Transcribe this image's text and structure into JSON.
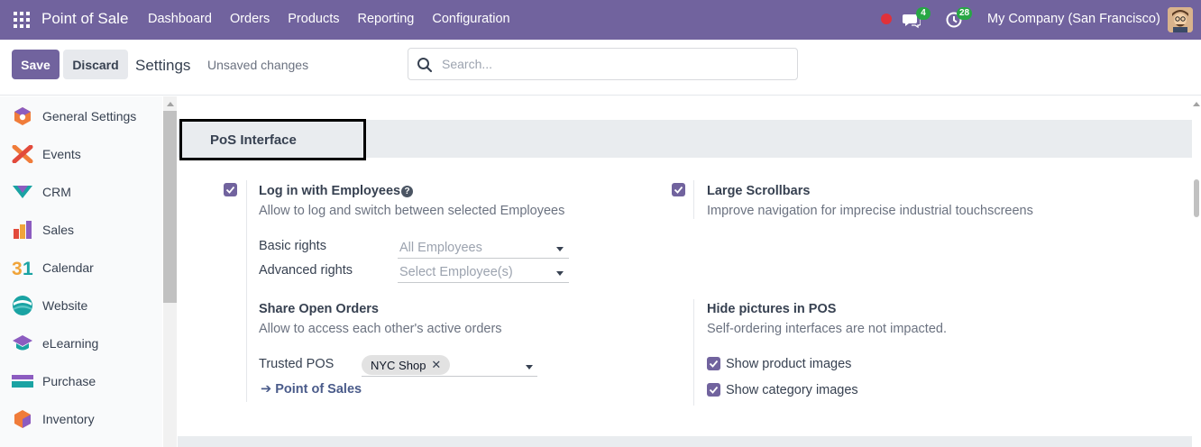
{
  "navbar": {
    "app_name": "Point of Sale",
    "menu": [
      "Dashboard",
      "Orders",
      "Products",
      "Reporting",
      "Configuration"
    ],
    "chat_count": "4",
    "activity_count": "28",
    "company": "My Company (San Francisco)",
    "colors": {
      "bar": "#71639e",
      "badge": "#28a745",
      "record": "#e0313a"
    }
  },
  "control": {
    "save_label": "Save",
    "discard_label": "Discard",
    "title": "Settings",
    "status": "Unsaved changes",
    "search_placeholder": "Search..."
  },
  "sidebar": {
    "items": [
      {
        "label": "General Settings",
        "icon": "general-settings-icon"
      },
      {
        "label": "Events",
        "icon": "events-icon"
      },
      {
        "label": "CRM",
        "icon": "crm-icon"
      },
      {
        "label": "Sales",
        "icon": "sales-icon"
      },
      {
        "label": "Calendar",
        "icon": "calendar-icon"
      },
      {
        "label": "Website",
        "icon": "website-icon"
      },
      {
        "label": "eLearning",
        "icon": "elearning-icon"
      },
      {
        "label": "Purchase",
        "icon": "purchase-icon"
      },
      {
        "label": "Inventory",
        "icon": "inventory-icon"
      }
    ]
  },
  "section": {
    "title": "PoS Interface",
    "login": {
      "title": "Log in with Employees",
      "description": "Allow to log and switch between selected Employees",
      "checked": true,
      "basic_rights_label": "Basic rights",
      "basic_rights_placeholder": "All Employees",
      "advanced_rights_label": "Advanced rights",
      "advanced_rights_placeholder": "Select Employee(s)"
    },
    "scrollbars": {
      "title": "Large Scrollbars",
      "description": "Improve navigation for imprecise industrial touchscreens",
      "checked": true
    },
    "share_orders": {
      "title": "Share Open Orders",
      "description": "Allow to access each other's active orders",
      "trusted_label": "Trusted POS",
      "trusted_tag": "NYC Shop",
      "link_label": "Point of Sales"
    },
    "hide_pictures": {
      "title": "Hide pictures in POS",
      "description": "Self-ordering interfaces are not impacted.",
      "product_images_label": "Show product images",
      "product_images_checked": true,
      "category_images_label": "Show category images",
      "category_images_checked": true
    }
  }
}
